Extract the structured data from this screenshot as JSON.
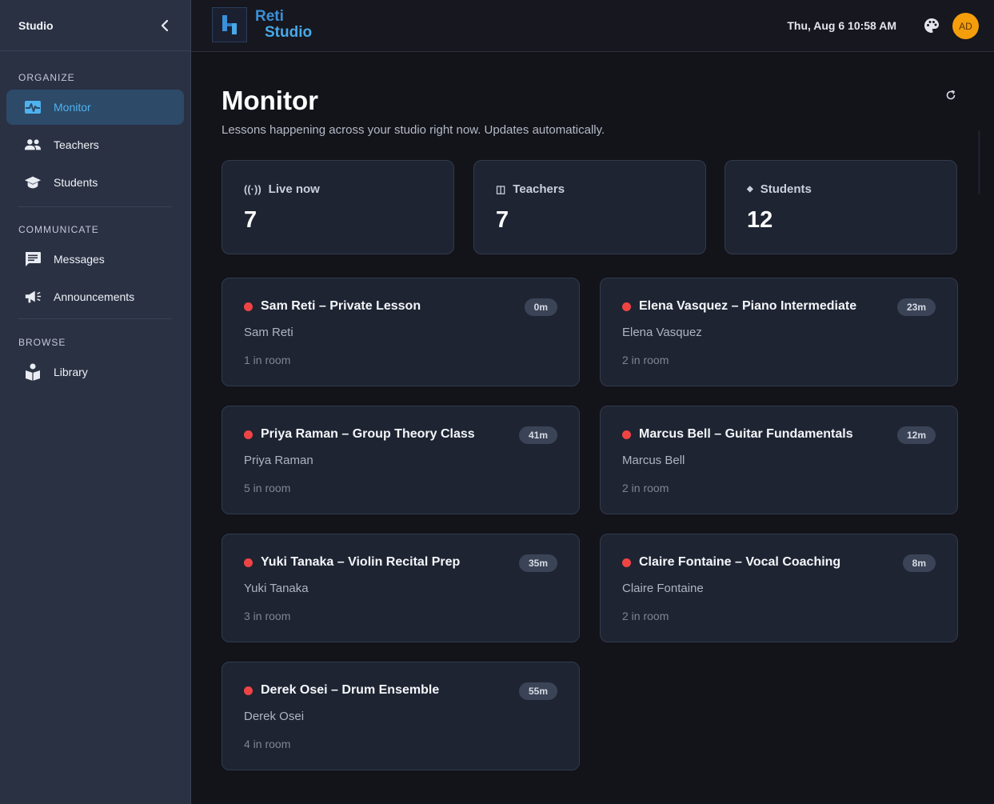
{
  "sidebar": {
    "title": "Studio",
    "sections": [
      {
        "label": "ORGANIZE",
        "items": [
          {
            "label": "Monitor",
            "icon": "monitor-heart-icon",
            "active": true
          },
          {
            "label": "Teachers",
            "icon": "people-icon"
          },
          {
            "label": "Students",
            "icon": "graduation-cap-icon"
          }
        ]
      },
      {
        "label": "COMMUNICATE",
        "items": [
          {
            "label": "Messages",
            "icon": "chat-icon"
          },
          {
            "label": "Announcements",
            "icon": "megaphone-icon"
          }
        ]
      },
      {
        "label": "BROWSE",
        "items": [
          {
            "label": "Library",
            "icon": "book-reader-icon"
          }
        ]
      }
    ]
  },
  "header": {
    "logo_line1": "Reti",
    "logo_line2": "Studio",
    "datetime": "Thu, Aug 6 10:58 AM",
    "avatar_initials": "AD",
    "avatar_color": "#f59e0b"
  },
  "main": {
    "title": "Monitor",
    "subtitle": "Lessons happening across your studio right now. Updates automatically.",
    "stats": [
      {
        "label": "Live now",
        "value": "7",
        "icon": "broadcast-icon",
        "glyph": "((·))"
      },
      {
        "label": "Teachers",
        "value": "7",
        "icon": "columns-icon",
        "glyph": "◫"
      },
      {
        "label": "Students",
        "value": "12",
        "icon": "diamond-icon",
        "glyph": "◆"
      }
    ],
    "lessons": [
      {
        "title": "Sam Reti – Private Lesson",
        "teacher": "Sam Reti",
        "room": "1 in room",
        "duration": "0m"
      },
      {
        "title": "Elena Vasquez – Piano Intermediate",
        "teacher": "Elena Vasquez",
        "room": "2 in room",
        "duration": "23m"
      },
      {
        "title": "Priya Raman – Group Theory Class",
        "teacher": "Priya Raman",
        "room": "5 in room",
        "duration": "41m"
      },
      {
        "title": "Marcus Bell – Guitar Fundamentals",
        "teacher": "Marcus Bell",
        "room": "2 in room",
        "duration": "12m"
      },
      {
        "title": "Yuki Tanaka – Violin Recital Prep",
        "teacher": "Yuki Tanaka",
        "room": "3 in room",
        "duration": "35m"
      },
      {
        "title": "Claire Fontaine – Vocal Coaching",
        "teacher": "Claire Fontaine",
        "room": "2 in room",
        "duration": "8m"
      },
      {
        "title": "Derek Osei – Drum Ensemble",
        "teacher": "Derek Osei",
        "room": "4 in room",
        "duration": "55m"
      }
    ],
    "live_color": "#ef4444",
    "accent_color": "#4fb2ee"
  }
}
